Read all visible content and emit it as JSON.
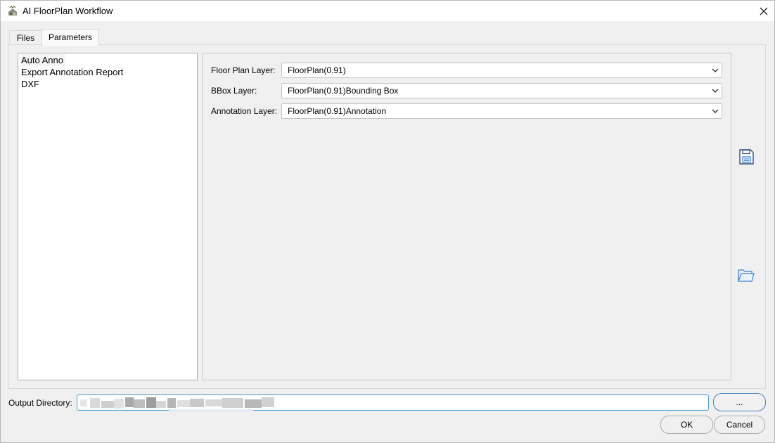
{
  "window": {
    "title": "AI FloorPlan Workflow",
    "icon": "app-icon",
    "close_icon": "close-icon"
  },
  "tabs": [
    {
      "label": "Files",
      "active": false
    },
    {
      "label": "Parameters",
      "active": true
    }
  ],
  "steps": [
    {
      "label": "Auto Anno",
      "selected": true
    },
    {
      "label": "Export Annotation Report",
      "selected": false
    },
    {
      "label": "DXF",
      "selected": false
    }
  ],
  "fields": [
    {
      "label": "Floor Plan Layer:",
      "value": "FloorPlan(0.91)"
    },
    {
      "label": "BBox Layer:",
      "value": "FloorPlan(0.91)Bounding Box"
    },
    {
      "label": "Annotation Layer:",
      "value": "FloorPlan(0.91)Annotation"
    }
  ],
  "side_icons": [
    "save-icon",
    "open-folder-icon"
  ],
  "output": {
    "label": "Output Directory:",
    "value": ""
  },
  "buttons": {
    "browse": "...",
    "ok": "OK",
    "cancel": "Cancel"
  },
  "colors": {
    "accent": "#4a9ccf",
    "icon_blue": "#3b7dd8",
    "background": "#f0f0f0"
  }
}
